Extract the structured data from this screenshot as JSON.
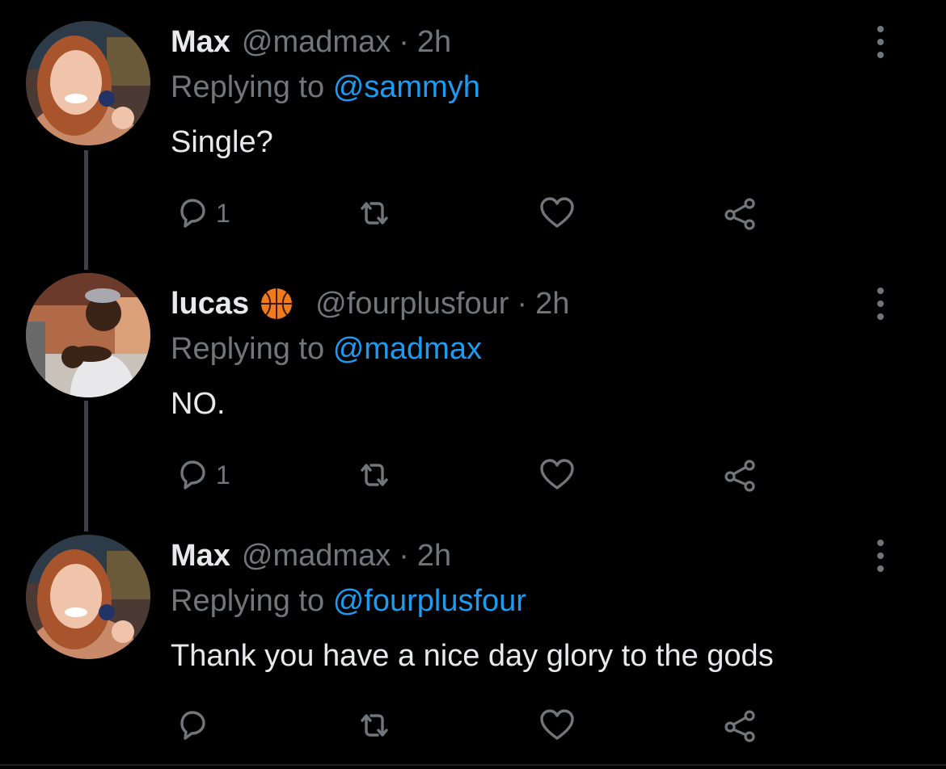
{
  "colors": {
    "background": "#000000",
    "link": "#1d9bf0",
    "muted": "#71767b",
    "text": "#e7e9ea"
  },
  "tweets": [
    {
      "name": "Max",
      "handle": "@madmax",
      "time": "2h",
      "replying_prefix": "Replying to",
      "replying_to": "@sammyh",
      "text": "Single?",
      "reply_count": "1",
      "emoji": null
    },
    {
      "name": "lucas",
      "handle": "@fourplusfour",
      "time": "2h",
      "replying_prefix": "Replying to",
      "replying_to": "@madmax",
      "text": "NO.",
      "reply_count": "1",
      "emoji": "basketball-icon"
    },
    {
      "name": "Max",
      "handle": "@madmax",
      "time": "2h",
      "replying_prefix": "Replying to",
      "replying_to": "@fourplusfour",
      "text": "Thank you have a nice day glory to the gods",
      "reply_count": "",
      "emoji": null
    }
  ],
  "icons": [
    "reply-icon",
    "retweet-icon",
    "like-icon",
    "share-icon",
    "more-icon"
  ]
}
